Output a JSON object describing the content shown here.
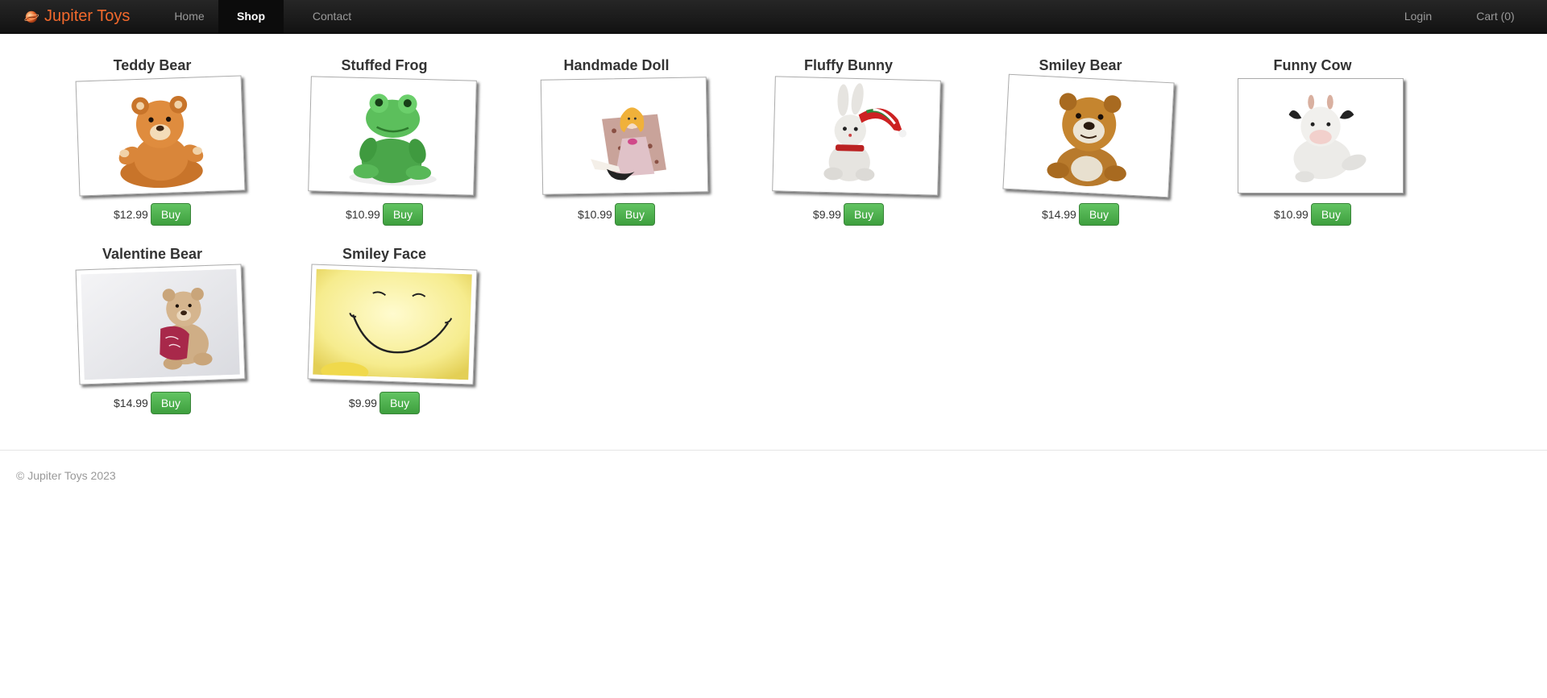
{
  "app": {
    "brand": "Jupiter Toys",
    "accent_color": "#f2692c",
    "active_nav": "Shop"
  },
  "nav": {
    "home": "Home",
    "shop": "Shop",
    "contact": "Contact",
    "login": "Login",
    "cart": "Cart (0)"
  },
  "products": [
    {
      "title": "Teddy Bear",
      "price": "$12.99",
      "buy_label": "Buy",
      "image_icon": "teddy-bear"
    },
    {
      "title": "Stuffed Frog",
      "price": "$10.99",
      "buy_label": "Buy",
      "image_icon": "stuffed-frog"
    },
    {
      "title": "Handmade Doll",
      "price": "$10.99",
      "buy_label": "Buy",
      "image_icon": "handmade-doll"
    },
    {
      "title": "Fluffy Bunny",
      "price": "$9.99",
      "buy_label": "Buy",
      "image_icon": "fluffy-bunny"
    },
    {
      "title": "Smiley Bear",
      "price": "$14.99",
      "buy_label": "Buy",
      "image_icon": "smiley-bear"
    },
    {
      "title": "Funny Cow",
      "price": "$10.99",
      "buy_label": "Buy",
      "image_icon": "funny-cow"
    },
    {
      "title": "Valentine Bear",
      "price": "$14.99",
      "buy_label": "Buy",
      "image_icon": "valentine-bear"
    },
    {
      "title": "Smiley Face",
      "price": "$9.99",
      "buy_label": "Buy",
      "image_icon": "smiley-face"
    }
  ],
  "footer": {
    "copyright": "© Jupiter Toys 2023"
  },
  "colors": {
    "navbar": "#1b1b1b",
    "buy_button": "#51b351",
    "footer_text": "#999999"
  }
}
